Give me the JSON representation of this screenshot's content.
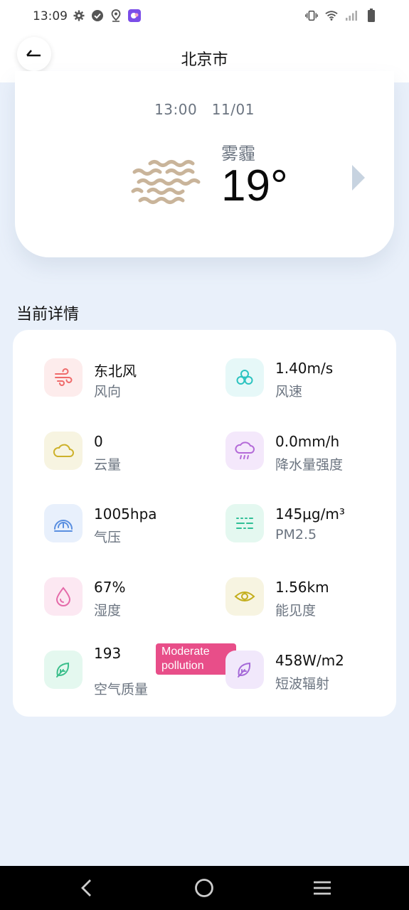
{
  "status_bar": {
    "time": "13:09",
    "left_icons": [
      "settings-icon",
      "check-circle-icon",
      "location-icon",
      "app-notification-icon"
    ],
    "right_icons": [
      "vibrate-icon",
      "wifi-icon",
      "signal-icon",
      "battery-icon"
    ]
  },
  "header": {
    "title": "北京市",
    "back_icon": "back-arrow-icon"
  },
  "current": {
    "time": "13:00",
    "date": "11/01",
    "condition": "雾霾",
    "temperature": "19°",
    "icon": "haze-icon",
    "next_icon": "chevron-right-icon"
  },
  "details": {
    "title": "当前详情",
    "items": [
      {
        "value": "东北风",
        "label": "风向",
        "icon": "wind-direction-icon",
        "color": "#ef6a6a",
        "bg": "#fdecec"
      },
      {
        "value": "1.40m/s",
        "label": "风速",
        "icon": "fan-icon",
        "color": "#2cc3c0",
        "bg": "#e6f8f8"
      },
      {
        "value": "0",
        "label": "云量",
        "icon": "cloud-icon",
        "color": "#cdb12a",
        "bg": "#f7f4e1"
      },
      {
        "value": "0.0mm/h",
        "label": "降水量强度",
        "icon": "rain-cloud-icon",
        "color": "#b46ad8",
        "bg": "#f4e8fb"
      },
      {
        "value": "1005hpa",
        "label": "气压",
        "icon": "gauge-icon",
        "color": "#5a8fe0",
        "bg": "#e8f0fc"
      },
      {
        "value": "145μg/m³",
        "label": "PM2.5",
        "icon": "haze-lines-icon",
        "color": "#2fbf96",
        "bg": "#e4f8f0"
      },
      {
        "value": "67%",
        "label": "湿度",
        "icon": "droplet-icon",
        "color": "#e56aa9",
        "bg": "#fce8f2"
      },
      {
        "value": "1.56km",
        "label": "能见度",
        "icon": "eye-icon",
        "color": "#c3ae1c",
        "bg": "#f7f4e1"
      },
      {
        "value": "193",
        "label": "空气质量",
        "icon": "leaf-icon",
        "color": "#3cbf8c",
        "bg": "#e4f8ef",
        "badge": "Moderate pollution",
        "badge_color": "#e84e89"
      },
      {
        "value": "458W/m2",
        "label": "短波辐射",
        "icon": "leaf-icon",
        "color": "#a56ad8",
        "bg": "#f1e8fb"
      }
    ]
  },
  "navbar": {
    "back_icon": "nav-back-icon",
    "home_icon": "nav-home-icon",
    "recents_icon": "nav-menu-icon"
  }
}
